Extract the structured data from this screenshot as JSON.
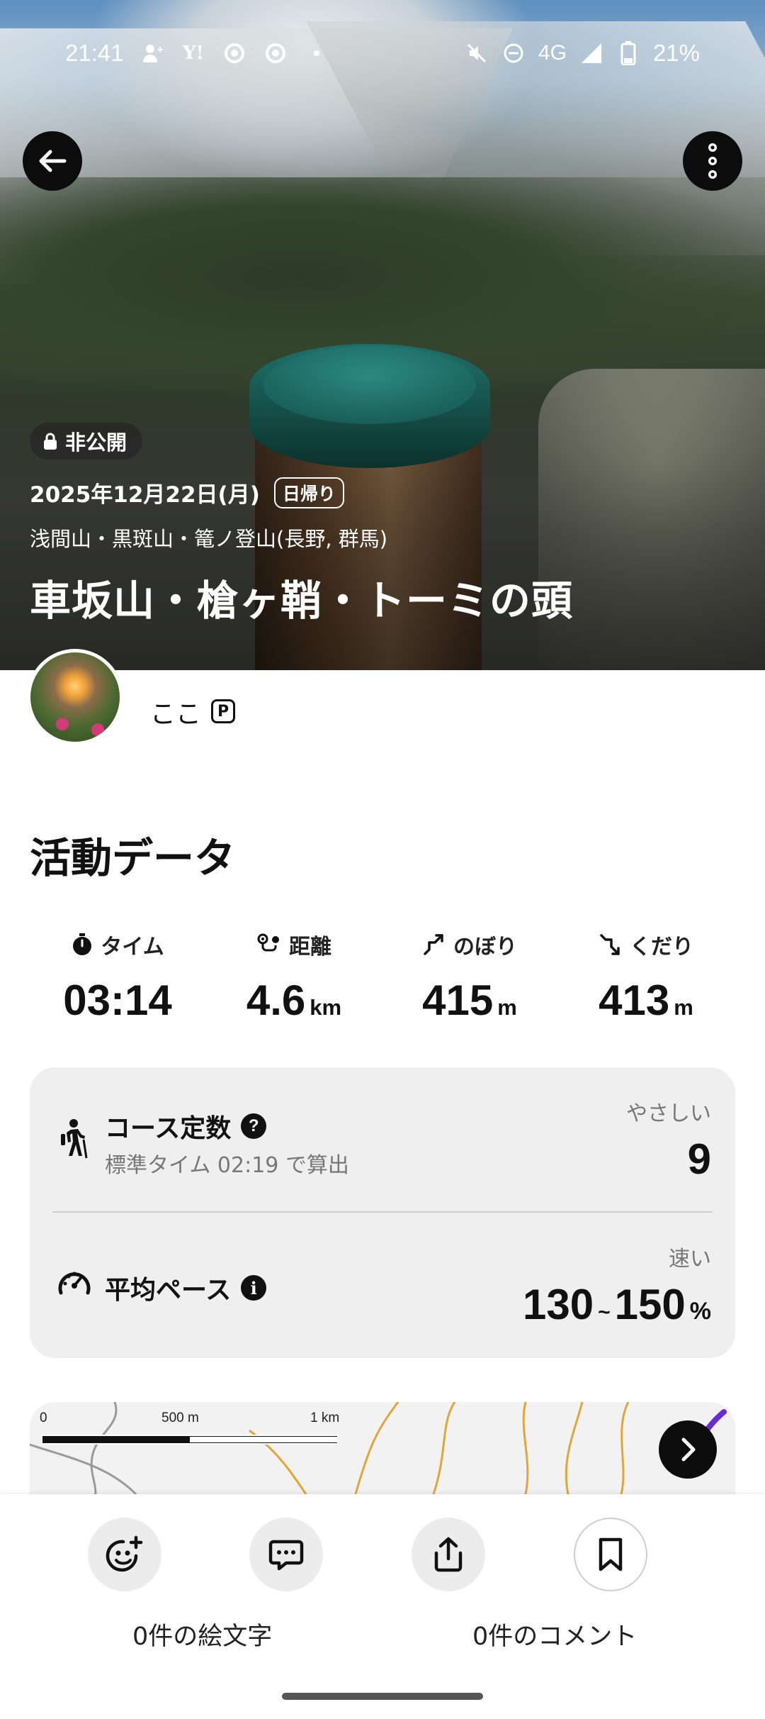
{
  "status_bar": {
    "time": "21:41",
    "network": "4G",
    "battery": "21%"
  },
  "hero": {
    "visibility_badge": "非公開",
    "date": "2025年12月22日(月)",
    "trip_type": "日帰り",
    "mountains": "浅間山・黒斑山・篭ノ登山(長野, 群馬)",
    "title": "車坂山・槍ヶ鞘・トーミの頭"
  },
  "user": {
    "name": "ここ",
    "badge": "P"
  },
  "activity": {
    "section_title": "活動データ",
    "stats": [
      {
        "label": "タイム",
        "value": "03:14",
        "unit": "",
        "icon": "stopwatch-icon"
      },
      {
        "label": "距離",
        "value": "4.6",
        "unit": "km",
        "icon": "route-icon"
      },
      {
        "label": "のぼり",
        "value": "415",
        "unit": "m",
        "icon": "ascent-icon"
      },
      {
        "label": "くだり",
        "value": "413",
        "unit": "m",
        "icon": "descent-icon"
      }
    ]
  },
  "course": {
    "constant_label": "コース定数",
    "standard_time": "標準タイム 02:19 で算出",
    "difficulty": "やさしい",
    "constant_value": "9",
    "pace_label": "平均ペース",
    "pace_level": "速い",
    "pace_min": "130",
    "pace_sep": "~",
    "pace_max": "150",
    "pace_unit": "%"
  },
  "map": {
    "scale_0": "0",
    "scale_mid": "500 m",
    "scale_max": "1 km"
  },
  "actions": {
    "emoji_count": "0件の絵文字",
    "comment_count": "0件のコメント"
  },
  "colors": {
    "accent": "#111111",
    "card_bg": "#efefef",
    "route_purple": "#6a2bd0"
  }
}
